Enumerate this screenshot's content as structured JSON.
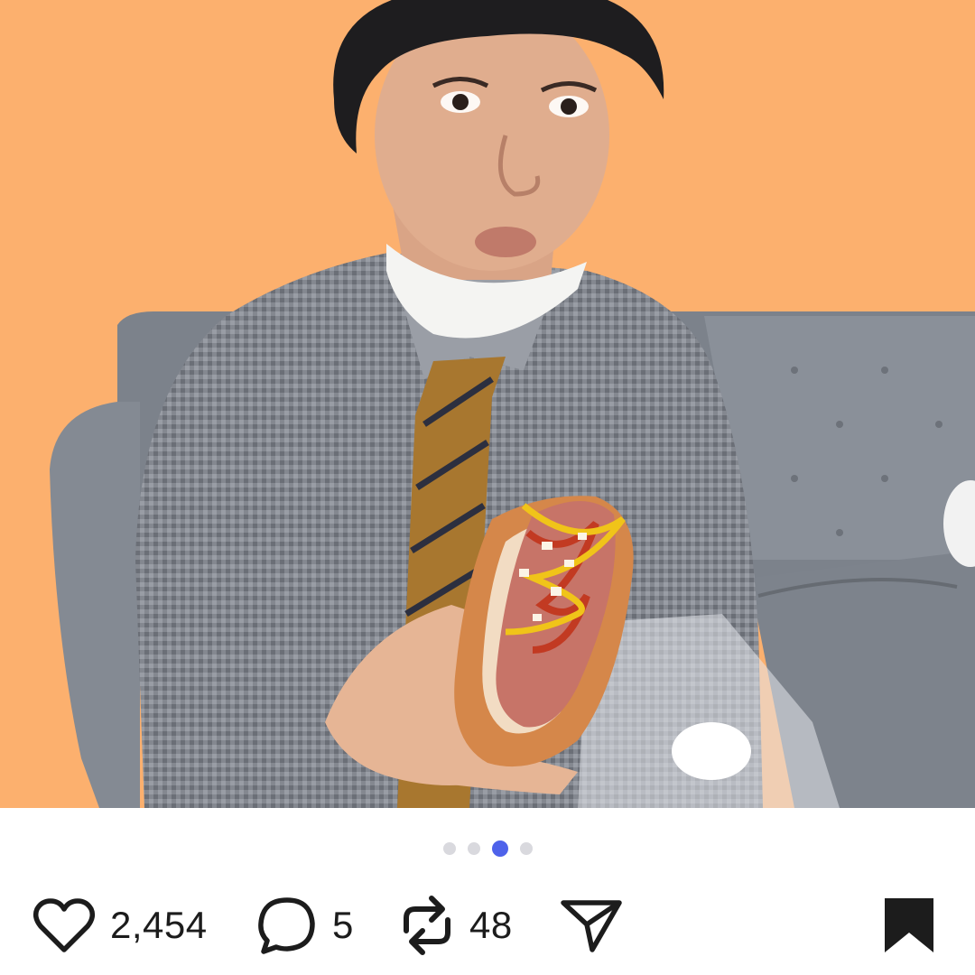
{
  "post": {
    "image": {
      "description_icon": "photo",
      "background_color": "#fcb06e"
    },
    "carousel": {
      "total": 4,
      "active_index": 2,
      "active_color": "#4e62ea",
      "inactive_color": "#d9d9de"
    },
    "actions": {
      "like": {
        "icon": "heart-outline-icon",
        "count": "2,454"
      },
      "comment": {
        "icon": "speech-bubble-icon",
        "count": "5"
      },
      "repost": {
        "icon": "repost-arrows-icon",
        "count": "48"
      },
      "share": {
        "icon": "paper-plane-icon"
      },
      "bookmark": {
        "icon": "bookmark-filled-icon"
      }
    }
  }
}
